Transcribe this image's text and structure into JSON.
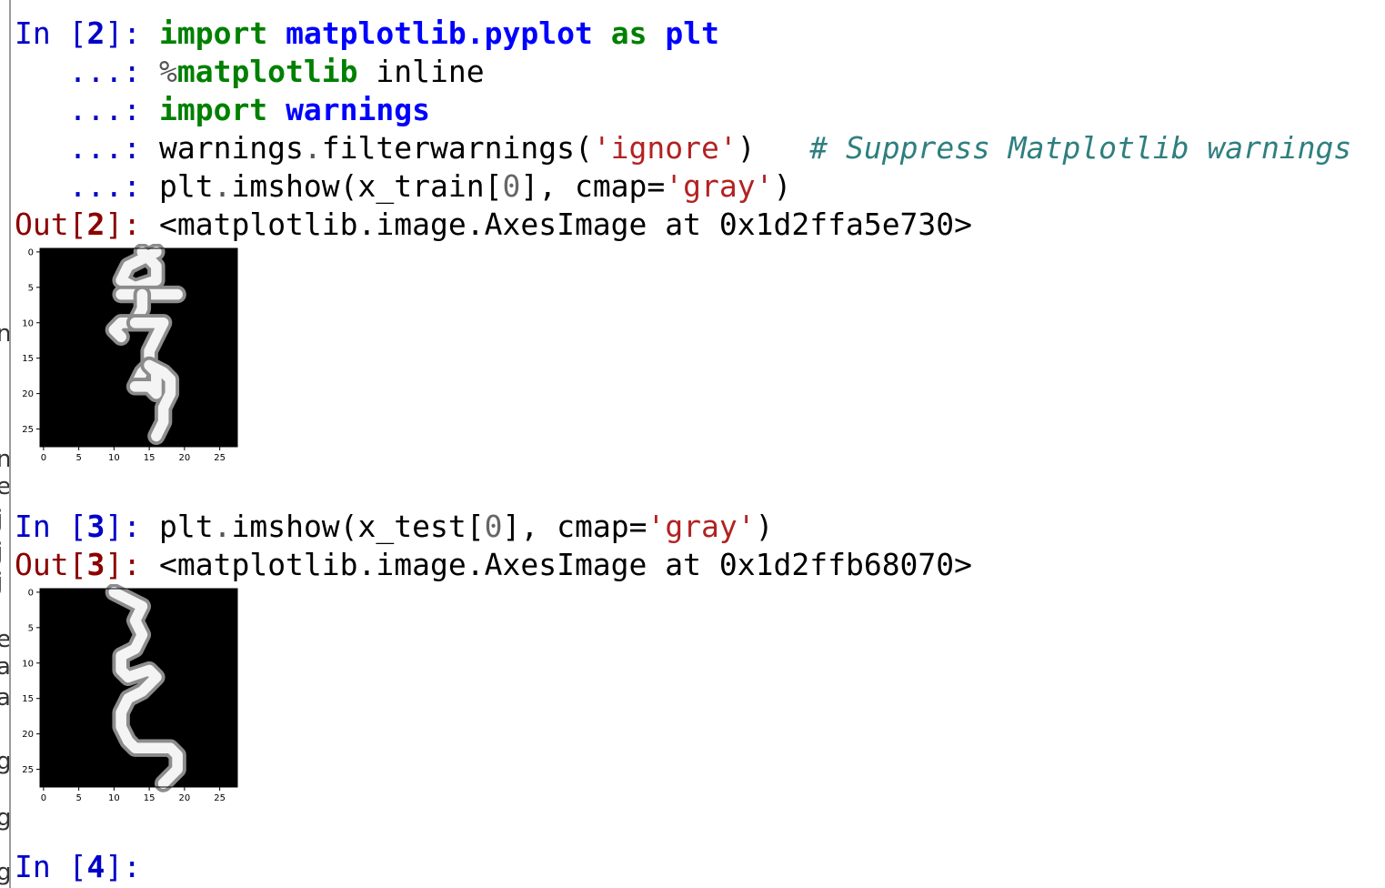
{
  "cells": [
    {
      "input_prompt": "In [",
      "number": "2",
      "prompt_close": "]:",
      "continuation": "...:",
      "lines": [
        {
          "kw": "import",
          "mod": "matplotlib.pyplot",
          "kw2": "as",
          "alias": "plt"
        },
        {
          "pct": "%",
          "magic": "matplotlib",
          "arg": " inline"
        },
        {
          "kw": "import",
          "mod": "warnings"
        },
        {
          "obj": "warnings",
          "dot": ".",
          "func": "filterwarnings(",
          "str": "'ignore'",
          "close": ")",
          "comment": "# Suppress Matplotlib warnings"
        },
        {
          "obj": "plt",
          "dot": ".",
          "func": "imshow(x_train[",
          "digit": "0",
          "mid": "], cmap=",
          "str": "'gray'",
          "close": ")"
        }
      ],
      "output_prompt": "Out[",
      "output_text": "<matplotlib.image.AxesImage at 0x1d2ffa5e730>"
    },
    {
      "input_prompt": "In [",
      "number": "3",
      "prompt_close": "]:",
      "lines": [
        {
          "obj": "plt",
          "dot": ".",
          "func": "imshow(x_test[",
          "digit": "0",
          "mid": "], cmap=",
          "str": "'gray'",
          "close": ")"
        }
      ],
      "output_prompt": "Out[",
      "output_text": "<matplotlib.image.AxesImage at 0x1d2ffb68070>"
    },
    {
      "input_prompt": "In [",
      "number": "4",
      "prompt_close": "]:"
    }
  ],
  "chart_data": [
    {
      "type": "heatmap",
      "image": "x_train[0]",
      "cmap": "gray",
      "x_ticks": [
        "0",
        "5",
        "10",
        "15",
        "20",
        "25"
      ],
      "y_ticks": [
        "0",
        "5",
        "10",
        "15",
        "20",
        "25"
      ],
      "xlim": [
        -0.5,
        27.5
      ],
      "ylim": [
        27.5,
        -0.5
      ],
      "strokes": [
        [
          [
            16,
            0
          ],
          [
            14,
            1
          ],
          [
            12,
            2
          ],
          [
            11,
            4
          ],
          [
            13,
            5
          ],
          [
            16,
            4
          ],
          [
            16,
            2
          ],
          [
            14,
            0
          ]
        ],
        [
          [
            11,
            6
          ],
          [
            14,
            6
          ],
          [
            16,
            6
          ],
          [
            19,
            6
          ]
        ],
        [
          [
            14,
            6
          ],
          [
            14,
            8
          ],
          [
            13,
            10
          ],
          [
            11,
            10
          ],
          [
            10,
            11
          ],
          [
            11,
            12
          ]
        ],
        [
          [
            13,
            10
          ],
          [
            17,
            10
          ],
          [
            16,
            12
          ],
          [
            15,
            14
          ],
          [
            15,
            16
          ],
          [
            14,
            17
          ],
          [
            13,
            19
          ]
        ],
        [
          [
            13,
            19
          ],
          [
            15,
            19
          ],
          [
            16,
            20
          ],
          [
            16,
            17
          ],
          [
            15,
            16
          ],
          [
            17,
            17
          ],
          [
            18,
            18
          ],
          [
            18,
            20
          ],
          [
            17,
            22
          ],
          [
            17,
            24
          ],
          [
            16,
            26
          ]
        ]
      ]
    },
    {
      "type": "heatmap",
      "image": "x_test[0]",
      "cmap": "gray",
      "x_ticks": [
        "0",
        "5",
        "10",
        "15",
        "20",
        "25"
      ],
      "y_ticks": [
        "0",
        "5",
        "10",
        "15",
        "20",
        "25"
      ],
      "xlim": [
        -0.5,
        27.5
      ],
      "ylim": [
        27.5,
        -0.5
      ],
      "strokes": [
        [
          [
            10,
            0
          ],
          [
            12,
            1
          ],
          [
            14,
            2
          ],
          [
            13,
            4
          ],
          [
            14,
            6
          ],
          [
            13,
            8
          ],
          [
            11,
            9
          ],
          [
            11,
            11
          ],
          [
            12,
            12
          ],
          [
            15,
            11
          ],
          [
            16,
            12
          ],
          [
            14,
            14
          ],
          [
            12,
            15
          ],
          [
            11,
            17
          ],
          [
            11,
            19
          ],
          [
            12,
            21
          ],
          [
            13,
            22
          ],
          [
            16,
            22
          ],
          [
            18,
            22
          ],
          [
            19,
            23
          ],
          [
            19,
            25
          ],
          [
            18,
            26
          ],
          [
            17,
            27
          ]
        ]
      ]
    }
  ]
}
